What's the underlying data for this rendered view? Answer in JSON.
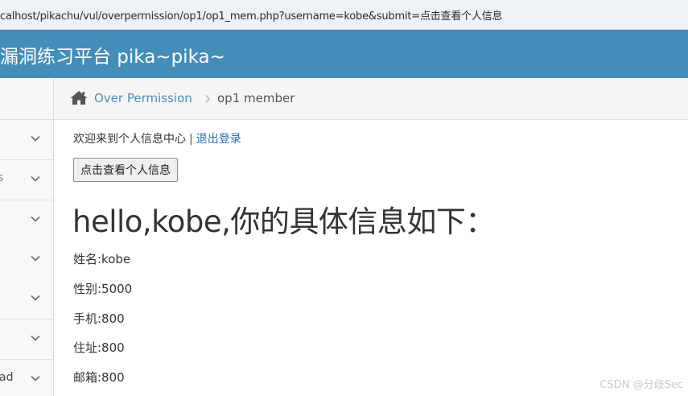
{
  "browser": {
    "url": "calhost/pikachu/vul/overpermission/op1/op1_mem.php?username=kobe&submit=点击查看个人信息"
  },
  "navbar": {
    "brand": "漏洞练习平台 pika~pika~",
    "color": "#438eb9"
  },
  "sidebar": {
    "items": [
      {
        "label_fragment": ""
      },
      {
        "label_fragment": "s"
      },
      {
        "label_fragment": ""
      },
      {
        "label_fragment": ""
      },
      {
        "label_fragment": ""
      },
      {
        "label_fragment": ""
      },
      {
        "label_fragment": "ad"
      }
    ]
  },
  "breadcrumb": {
    "home_icon": "home-icon",
    "link": "Over Permission",
    "current": "op1 member"
  },
  "main": {
    "welcome_text": "欢迎来到个人信息中心",
    "separator": "|",
    "logout_label": "退出登录",
    "view_button": "点击查看个人信息",
    "greeting": "hello,kobe,你的具体信息如下：",
    "info": {
      "name": "姓名:kobe",
      "gender": "性别:5000",
      "phone": "手机:800",
      "address": "住址:800",
      "email": "邮箱:800"
    }
  },
  "watermark": "CSDN @分歧Sec"
}
